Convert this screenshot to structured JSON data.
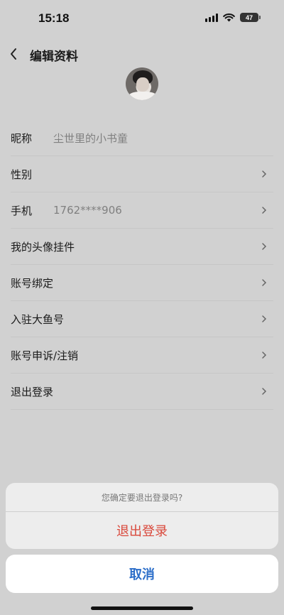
{
  "status_bar": {
    "time": "15:18",
    "battery": "47",
    "icons": [
      "signal-icon",
      "wifi-icon",
      "battery-icon"
    ]
  },
  "nav": {
    "title": "编辑资料",
    "back_icon": "chevron-left-icon"
  },
  "profile": {
    "rows": [
      {
        "label": "昵称",
        "value": "尘世里的小书童",
        "chevron": false
      },
      {
        "label": "性别",
        "value": "",
        "chevron": true
      },
      {
        "label": "手机",
        "value": "1762****906",
        "chevron": true
      },
      {
        "label": "我的头像挂件",
        "value": "",
        "chevron": true
      },
      {
        "label": "账号绑定",
        "value": "",
        "chevron": true
      },
      {
        "label": "入驻大鱼号",
        "value": "",
        "chevron": true
      },
      {
        "label": "账号申诉/注销",
        "value": "",
        "chevron": true
      },
      {
        "label": "退出登录",
        "value": "",
        "chevron": true
      }
    ]
  },
  "action_sheet": {
    "message": "您确定要退出登录吗?",
    "confirm_label": "退出登录",
    "cancel_label": "取消",
    "confirm_color": "#d9483b",
    "cancel_color": "#2c6ec9"
  }
}
